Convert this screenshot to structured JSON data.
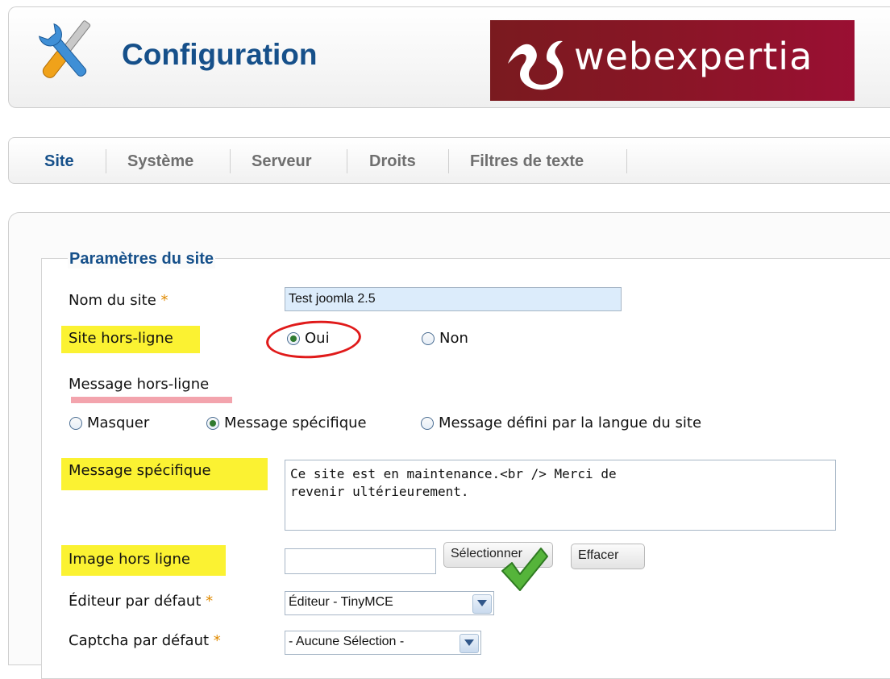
{
  "header": {
    "title": "Configuration",
    "logo_text": "webexpertia"
  },
  "tabs": [
    {
      "label": "Site",
      "active": true
    },
    {
      "label": "Système",
      "active": false
    },
    {
      "label": "Serveur",
      "active": false
    },
    {
      "label": "Droits",
      "active": false
    },
    {
      "label": "Filtres de texte",
      "active": false
    }
  ],
  "fieldset": {
    "legend": "Paramètres du site",
    "site_name": {
      "label": "Nom du site",
      "required_mark": "*",
      "value": "Test joomla 2.5"
    },
    "offline": {
      "label": "Site hors-ligne",
      "options": [
        "Oui",
        "Non"
      ],
      "selected": "Oui"
    },
    "offline_message": {
      "label": "Message hors-ligne",
      "options": [
        "Masquer",
        "Message spécifique",
        "Message défini par la langue du site"
      ],
      "selected": "Message spécifique"
    },
    "custom_message": {
      "label": "Message spécifique",
      "value": "Ce site est en maintenance.<br /> Merci de\nrevenir ultérieurement."
    },
    "offline_image": {
      "label": "Image hors ligne",
      "value": "",
      "select_button": "Sélectionner",
      "clear_button": "Effacer"
    },
    "default_editor": {
      "label": "Éditeur par défaut",
      "required_mark": "*",
      "value": "Éditeur - TinyMCE"
    },
    "default_captcha": {
      "label": "Captcha par défaut",
      "required_mark": "*",
      "value": "- Aucune Sélection -"
    }
  },
  "colors": {
    "title_blue": "#16508a",
    "highlight_yellow": "#fbf232",
    "annotation_red": "#e01a1a",
    "logo_bg": "#8b1527",
    "required_orange": "#e08a00"
  },
  "icons": [
    "tools-icon",
    "webexpertia-logo-icon",
    "check-mark-icon",
    "chevron-down-icon"
  ]
}
